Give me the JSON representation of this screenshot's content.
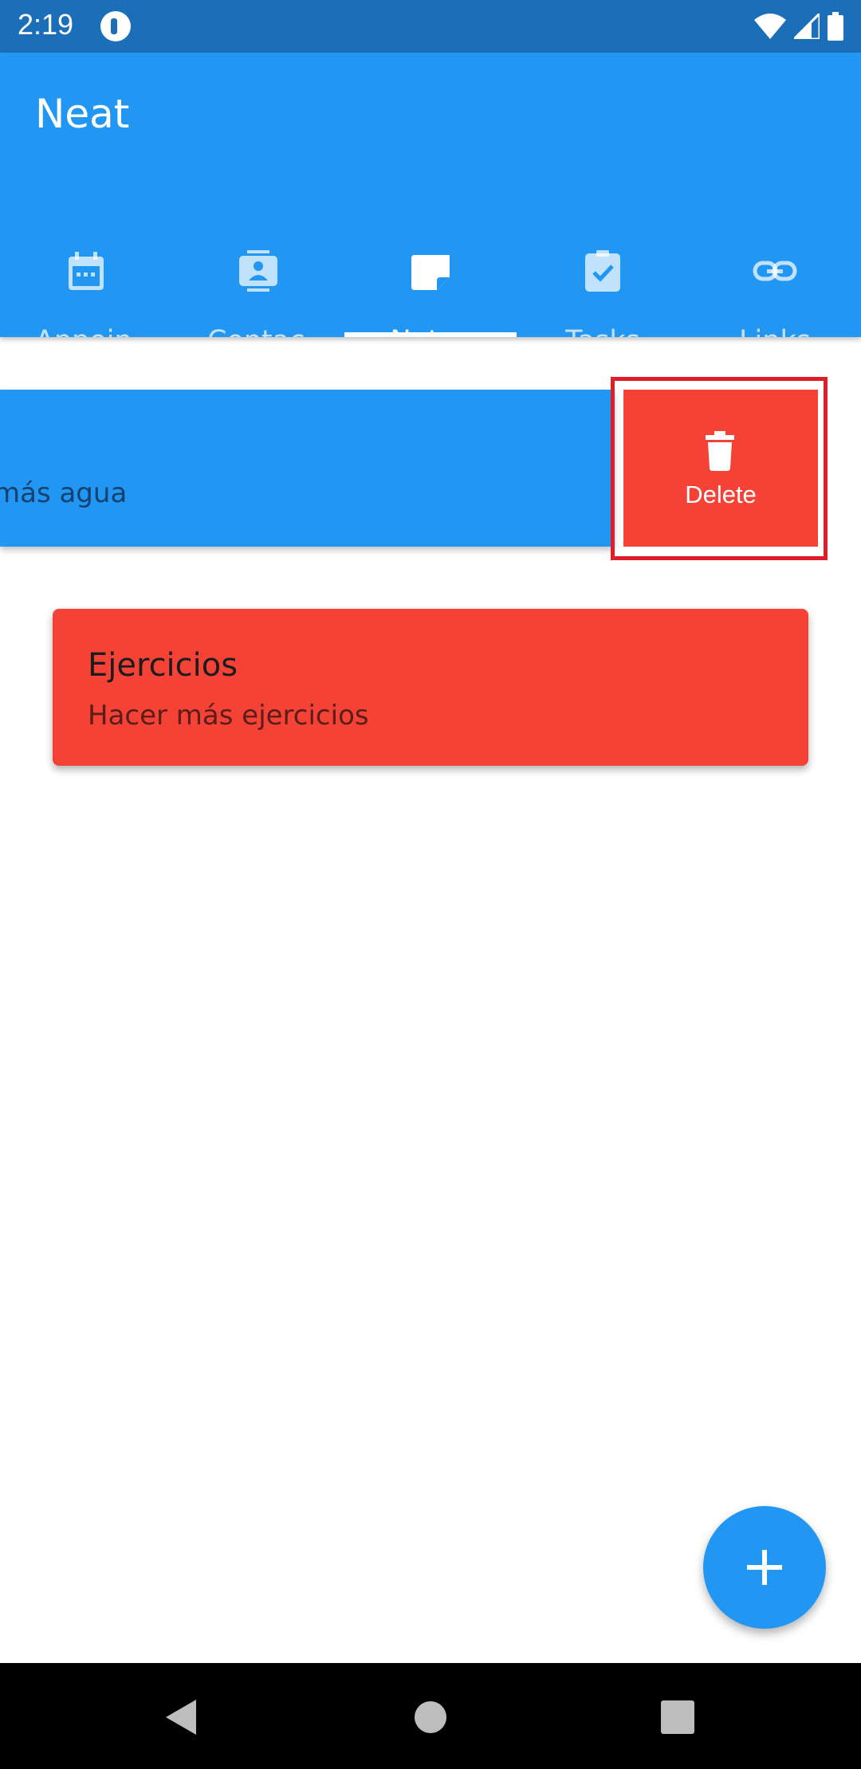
{
  "status_bar": {
    "time": "2:19"
  },
  "app": {
    "title": "Neat"
  },
  "tabs": [
    {
      "label": "Appoin",
      "icon": "calendar-icon"
    },
    {
      "label": "Contac",
      "icon": "contact-card-icon"
    },
    {
      "label": "Notes",
      "icon": "note-icon"
    },
    {
      "label": "Tasks",
      "icon": "clipboard-check-icon"
    },
    {
      "label": "Links",
      "icon": "link-icon"
    }
  ],
  "notes": [
    {
      "body": "más agua"
    },
    {
      "title": "Ejercicios",
      "body": "Hacer más ejercicios"
    }
  ],
  "delete_action": {
    "label": "Delete",
    "icon": "trash-icon"
  },
  "colors": {
    "primary": "#2196f3",
    "status_bar": "#1b6fb9",
    "danger": "#f44336"
  }
}
